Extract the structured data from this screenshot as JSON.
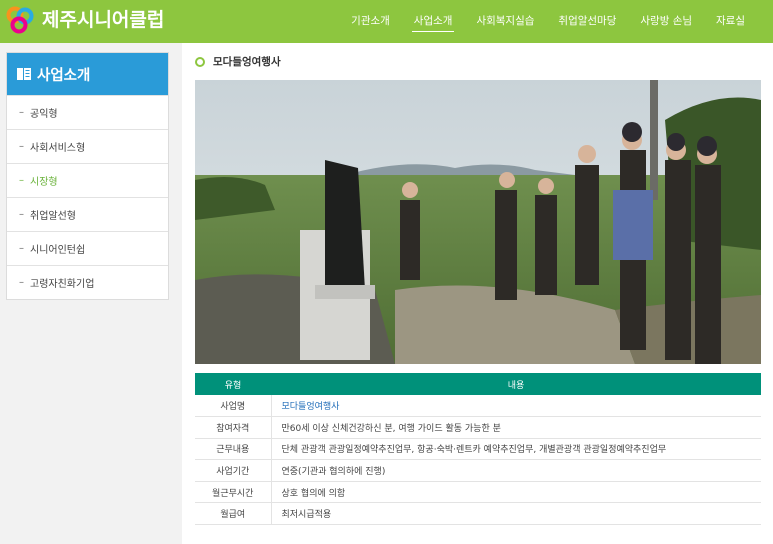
{
  "header": {
    "site_title": "제주시니어클럽",
    "nav": [
      {
        "label": "기관소개"
      },
      {
        "label": "사업소개"
      },
      {
        "label": "사회복지실습"
      },
      {
        "label": "취업알선마당"
      },
      {
        "label": "사랑방 손님"
      },
      {
        "label": "자료실"
      }
    ],
    "active_nav": "사업소개",
    "brand_color": "#8dc63f"
  },
  "sidebar": {
    "title": "사업소개",
    "items": [
      {
        "label": "공익형"
      },
      {
        "label": "사회서비스형"
      },
      {
        "label": "시장형"
      },
      {
        "label": "취업알선형"
      },
      {
        "label": "시니어인턴쉽"
      },
      {
        "label": "고령자친화기업"
      }
    ],
    "active_item": "시장형",
    "accent_color": "#2a9bd8"
  },
  "main": {
    "title": "모다들엉여행사",
    "table": {
      "headers": [
        "유형",
        "내용"
      ],
      "rows": [
        {
          "key": "사업명",
          "value": "모다들엉여행사"
        },
        {
          "key": "참여자격",
          "value": "만60세 이상 신체건강하신 분, 여행 가이드 활동 가능한 분"
        },
        {
          "key": "근무내용",
          "value": "단체 관광객 관광일정예약추진업무, 항공·숙박·렌트카 예약추진업무, 개별관광객 관광일정예약추진업무"
        },
        {
          "key": "사업기간",
          "value": "연중(기관과 협의하에 진행)"
        },
        {
          "key": "월근무시간",
          "value": "상호 협의에 의함"
        },
        {
          "key": "월급여",
          "value": "최저시급적용"
        }
      ],
      "header_color": "#00917a"
    }
  }
}
